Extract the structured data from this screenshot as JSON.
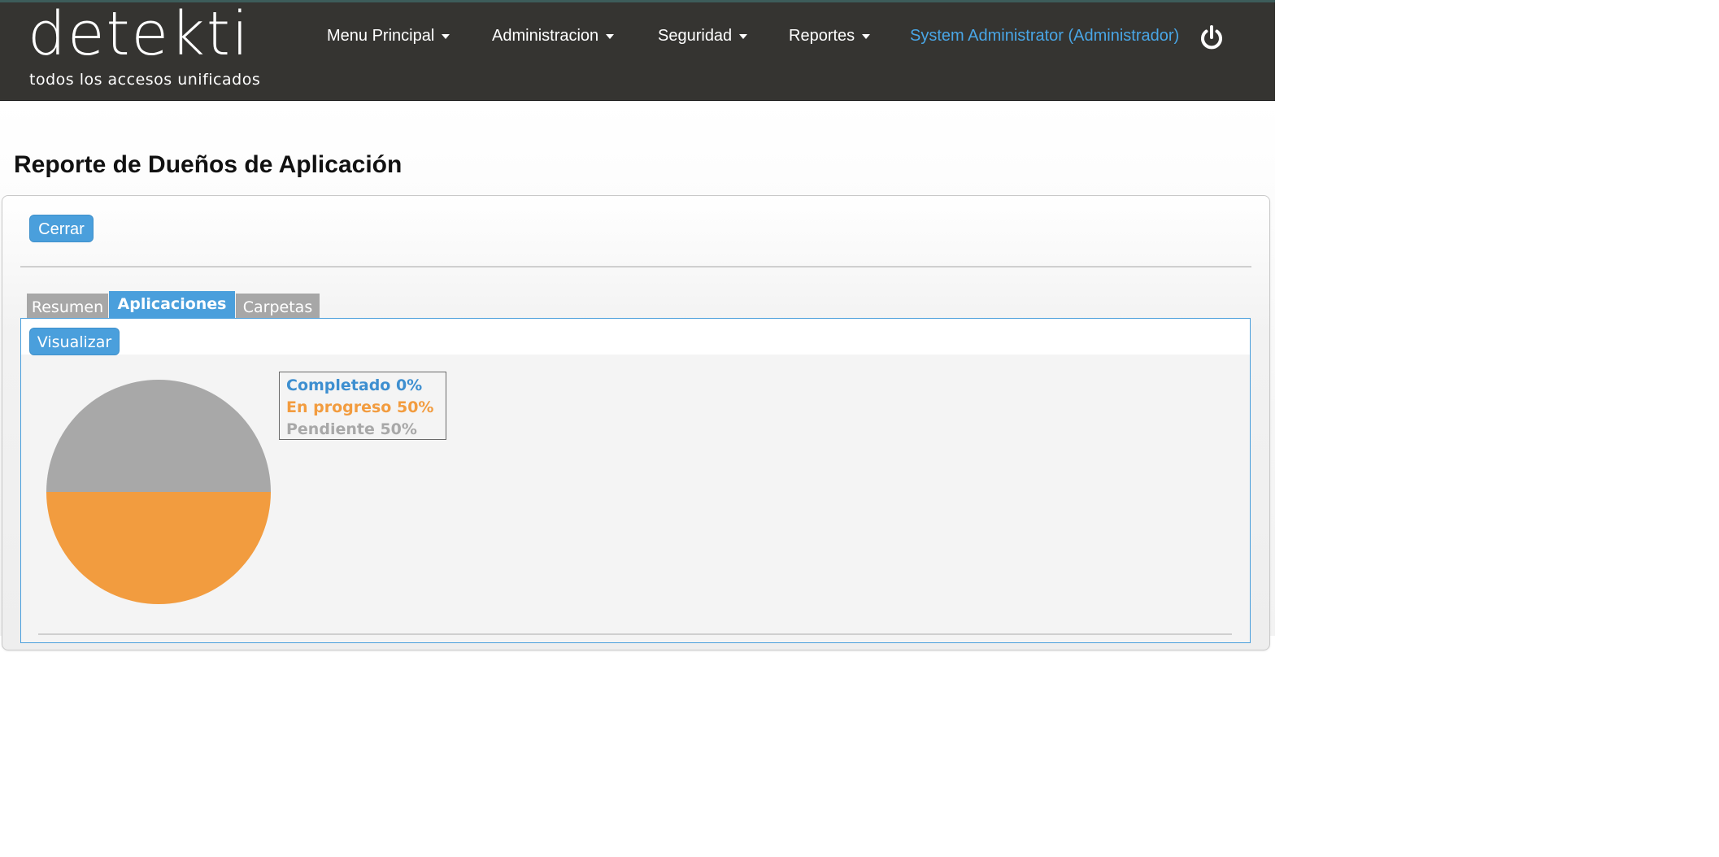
{
  "brand": {
    "name": "detekti",
    "tagline": "todos los accesos unificados"
  },
  "nav": {
    "items": [
      {
        "label": "Menu Principal"
      },
      {
        "label": "Administracion"
      },
      {
        "label": "Seguridad"
      },
      {
        "label": "Reportes"
      }
    ],
    "user_label": "System Administrator (Administrador)",
    "logout_icon": "power-icon"
  },
  "page": {
    "title": "Reporte de Dueños de Aplicación",
    "close_label": "Cerrar"
  },
  "tabs": [
    {
      "label": "Resumen",
      "active": false
    },
    {
      "label": "Aplicaciones",
      "active": true
    },
    {
      "label": "Carpetas",
      "active": false
    }
  ],
  "tab_content": {
    "visualize_label": "Visualizar"
  },
  "colors": {
    "accent": "#4a9fdc",
    "navbar": "#353431",
    "completed": "#3e8fd0",
    "in_progress": "#f29c3f",
    "pending": "#a8a8a8"
  },
  "chart_data": {
    "type": "pie",
    "title": "",
    "legend_position": "top-right",
    "slices": [
      {
        "label": "Completado",
        "value": 0,
        "display": "Completado 0%",
        "color": "#3e8fd0"
      },
      {
        "label": "En progreso",
        "value": 50,
        "display": "En progreso 50%",
        "color": "#f29c3f"
      },
      {
        "label": "Pendiente",
        "value": 50,
        "display": "Pendiente 50%",
        "color": "#a8a8a8"
      }
    ]
  }
}
